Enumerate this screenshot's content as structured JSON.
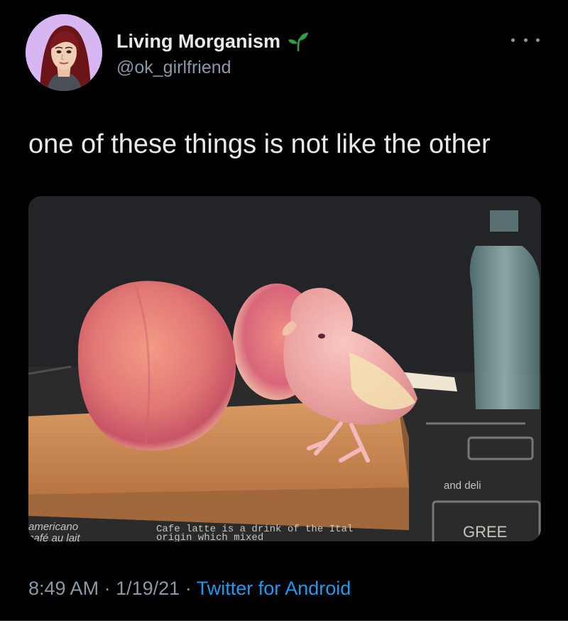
{
  "author": {
    "display_name": "Living Morganism",
    "handle": "@ok_girlfriend",
    "badge_icon": "sprout-icon",
    "avatar_bg": "#d7b6f1"
  },
  "tweet": {
    "text": "one of these things is not like the other"
  },
  "media": {
    "description_icon": "photo-peaches-and-pink-bird",
    "board_text": {
      "left_line1": "americano",
      "left_line2": "café au lait",
      "center_line1": "Cafe latte is a drink of the Ital",
      "center_line2": "origin which mixed",
      "right_line1": "and deli",
      "right_box": "GREE"
    }
  },
  "meta": {
    "time": "8:49 AM",
    "date": "1/19/21",
    "sep": "·",
    "source": "Twitter for Android"
  },
  "colors": {
    "background": "#000000",
    "text": "#e7e9ea",
    "secondary": "#8b98a5",
    "link": "#1d9bf0",
    "badge": "#2ea043"
  }
}
